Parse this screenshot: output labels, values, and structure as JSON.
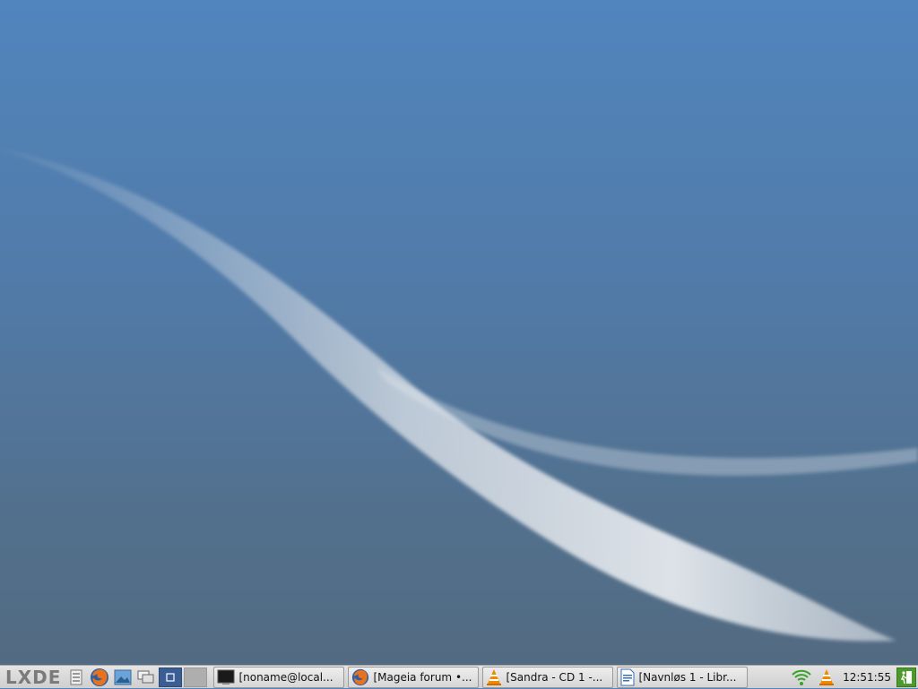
{
  "desktop": {
    "colors": {
      "bg_top": "#5185bd",
      "bg_bottom": "#536a80",
      "wave": "#dfe4ea"
    }
  },
  "taskbar": {
    "logo": "LXDE",
    "launchers": [
      {
        "icon": "file-manager-icon"
      },
      {
        "icon": "firefox-icon"
      },
      {
        "icon": "image-viewer-icon"
      },
      {
        "icon": "show-desktop-icon"
      }
    ],
    "desktops": [
      {
        "state": "active"
      },
      {
        "state": "inactive"
      }
    ],
    "tasks": [
      {
        "label": "[noname@local...",
        "icon": "terminal-icon"
      },
      {
        "label": "[Mageia forum •...",
        "icon": "firefox-icon"
      },
      {
        "label": "[Sandra - CD 1 -...",
        "icon": "vlc-icon"
      },
      {
        "label": "[Navnløs 1 - Libr...",
        "icon": "writer-document-icon"
      }
    ],
    "tray": {
      "icons": [
        "wifi-icon",
        "vlc-icon"
      ],
      "clock": "12:51:55",
      "exit_icon": "exit-icon"
    }
  }
}
